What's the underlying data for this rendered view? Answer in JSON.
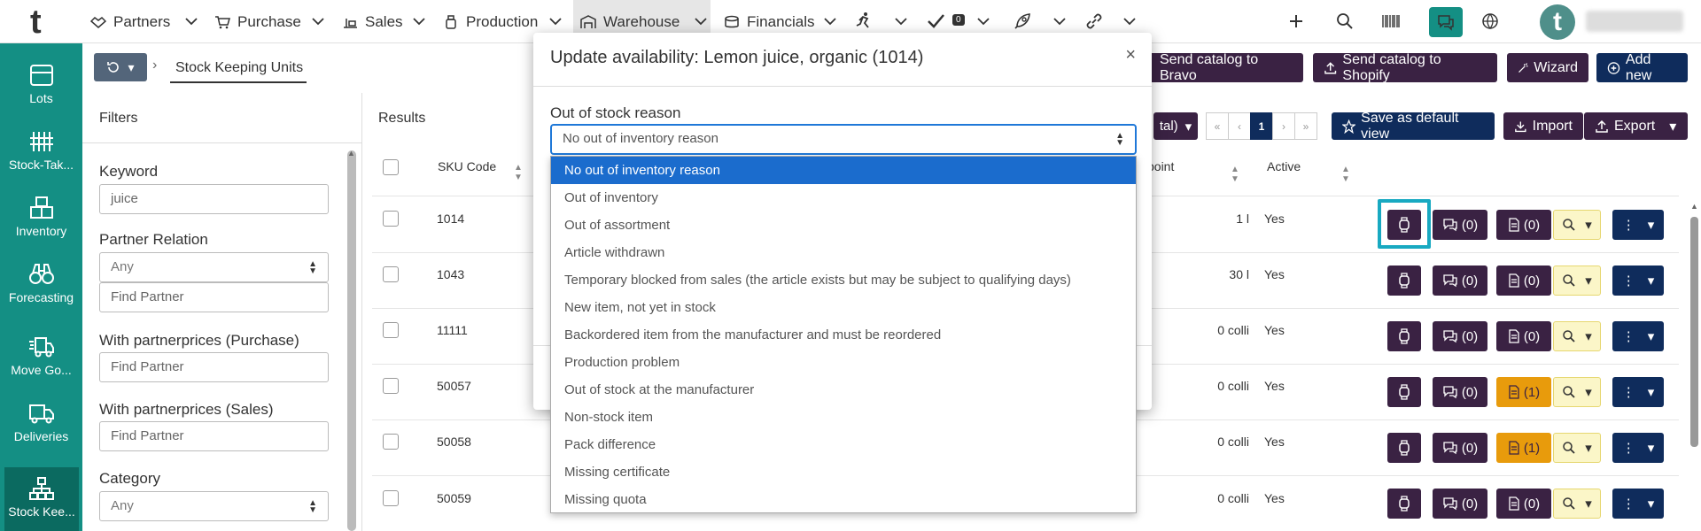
{
  "app": {
    "logo": "t",
    "avatar_letter": "t"
  },
  "nav": {
    "items": [
      {
        "label": "Partners"
      },
      {
        "label": "Purchase"
      },
      {
        "label": "Sales"
      },
      {
        "label": "Production"
      },
      {
        "label": "Warehouse"
      },
      {
        "label": "Financials"
      }
    ],
    "check_badge": "0"
  },
  "sidebar": {
    "items": [
      {
        "label": "Lots"
      },
      {
        "label": "Stock-Tak..."
      },
      {
        "label": "Inventory"
      },
      {
        "label": "Forecasting"
      },
      {
        "label": "Move Go..."
      },
      {
        "label": "Deliveries"
      },
      {
        "label": "Stock Kee..."
      }
    ]
  },
  "breadcrumb": {
    "current": "Stock Keeping Units"
  },
  "header_actions": {
    "send_bravo": "Send catalog to Bravo",
    "send_shopify": "Send catalog to Shopify",
    "wizard": "Wizard",
    "add_new": "Add new"
  },
  "filters": {
    "title": "Filters",
    "keyword_label": "Keyword",
    "keyword_value": "juice",
    "partner_relation_label": "Partner Relation",
    "partner_relation_value": "Any",
    "find_partner_placeholder": "Find Partner",
    "with_purchase_label": "With partnerprices (Purchase)",
    "with_sales_label": "With partnerprices (Sales)",
    "category_label": "Category",
    "category_value": "Any"
  },
  "results": {
    "title": "Results",
    "columns": {
      "sku": "SKU Code",
      "point": "point",
      "active": "Active"
    },
    "total_fragment": "tal)",
    "pager": {
      "first": "«",
      "prev": "‹",
      "current": "1",
      "next": "›",
      "last": "»"
    },
    "save_default": "Save as default view",
    "import": "Import",
    "export": "Export",
    "rows": [
      {
        "sku": "1014",
        "point": "1 l",
        "active": "Yes",
        "comments": "(0)",
        "docs": "(0)"
      },
      {
        "sku": "1043",
        "point": "30 l",
        "active": "Yes",
        "comments": "(0)",
        "docs": "(0)"
      },
      {
        "sku": "11111",
        "point": "0 colli",
        "active": "Yes",
        "comments": "(0)",
        "docs": "(0)"
      },
      {
        "sku": "50057",
        "point": "0 colli",
        "active": "Yes",
        "comments": "(0)",
        "docs": "(1)"
      },
      {
        "sku": "50058",
        "point": "0 colli",
        "active": "Yes",
        "comments": "(0)",
        "docs": "(1)"
      },
      {
        "sku": "50059",
        "point": "0 colli",
        "active": "Yes",
        "comments": "(0)",
        "docs": "(0)"
      }
    ]
  },
  "modal": {
    "title": "Update availability: Lemon juice, organic (1014)",
    "close": "×",
    "reason_label": "Out of stock reason",
    "reason_value": "No out of inventory reason",
    "options": [
      "No out of inventory reason",
      "Out of inventory",
      "Out of assortment",
      "Article withdrawn",
      "Temporary blocked from sales (the article exists but may be subject to qualifying days)",
      "New item, not yet in stock",
      "Backordered item from the manufacturer and must be reordered",
      "Production problem",
      "Out of stock at the manufacturer",
      "Non-stock item",
      "Pack difference",
      "Missing certificate",
      "Missing quota"
    ]
  },
  "colors": {
    "sidebar": "#148f84",
    "dark_button": "#3a2243",
    "navy_button": "#0f2c5c",
    "selected_option": "#1b6ccd",
    "highlight": "#18a9c1"
  }
}
